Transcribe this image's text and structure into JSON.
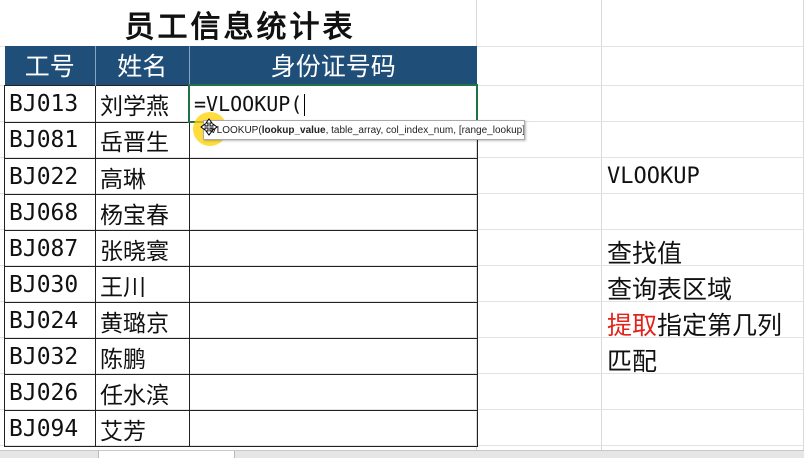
{
  "sheet": {
    "title": "员工信息统计表",
    "headers": [
      "工号",
      "姓名",
      "身份证号码"
    ],
    "rows": [
      {
        "id": "BJ013",
        "name": "刘学燕"
      },
      {
        "id": "BJ081",
        "name": "岳晋生"
      },
      {
        "id": "BJ022",
        "name": "高琳"
      },
      {
        "id": "BJ068",
        "name": "杨宝春"
      },
      {
        "id": "BJ087",
        "name": "张晓寰"
      },
      {
        "id": "BJ030",
        "name": "王川"
      },
      {
        "id": "BJ024",
        "name": "黄璐京"
      },
      {
        "id": "BJ032",
        "name": "陈鹏"
      },
      {
        "id": "BJ026",
        "name": "任水滨"
      },
      {
        "id": "BJ094",
        "name": "艾芳"
      }
    ],
    "active_formula": "=VLOOKUP("
  },
  "tooltip": {
    "prefix": "VLOOKUP(",
    "bold_arg": "lookup_value",
    "rest": ", table_array, col_index_num, [range_lookup])"
  },
  "notes": {
    "function": "VLOOKUP",
    "arg1": "查找值",
    "arg2": "查询表区域",
    "arg3_red": "提取",
    "arg3_rest": "指定第几列",
    "arg4": "匹配"
  },
  "colors": {
    "header_bg": "#1f4e79",
    "active_border": "#217346",
    "red_text": "#e2231a",
    "highlight": "#ffd200"
  }
}
